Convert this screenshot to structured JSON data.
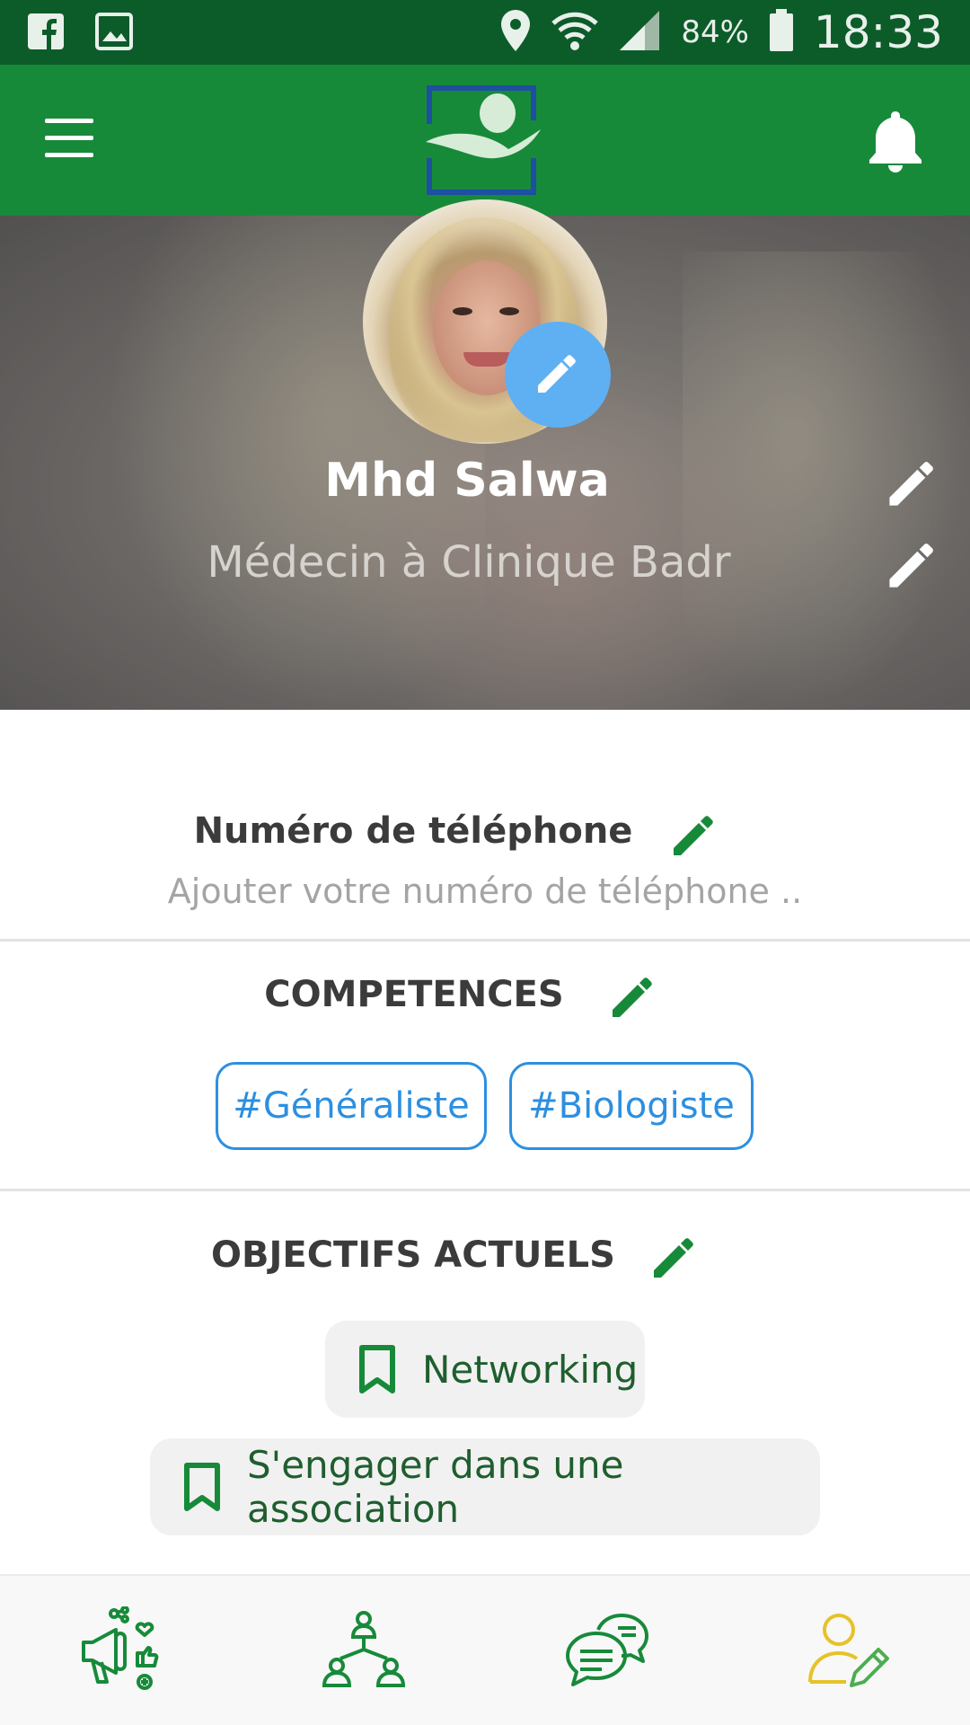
{
  "status_bar": {
    "battery": "84%",
    "time": "18:33",
    "icons": [
      "facebook-icon",
      "image-icon",
      "location-icon",
      "wifi-icon",
      "signal-icon",
      "battery-icon"
    ]
  },
  "app_bar": {
    "icons": [
      "menu-icon",
      "app-logo",
      "bell-icon"
    ]
  },
  "profile": {
    "name": "Mhd Salwa",
    "title": "Médecin à Clinique Badr"
  },
  "phone": {
    "label": "Numéro de téléphone",
    "placeholder": "Ajouter votre numéro de téléphone .."
  },
  "skills": {
    "label": "COMPETENCES",
    "items": [
      "#Généraliste",
      "#Biologiste"
    ]
  },
  "goals": {
    "label": "OBJECTIFS ACTUELS",
    "items": [
      "Networking",
      "S'engager dans une association"
    ]
  },
  "bottom_nav": {
    "items": [
      "megaphone-icon",
      "network-icon",
      "chat-icon",
      "profile-edit-icon"
    ],
    "active_index": 3
  },
  "colors": {
    "status_bar": "#0c5c2a",
    "app_bar": "#178a3a",
    "accent_green": "#178a3a",
    "chip_blue": "#2d8fe0",
    "avatar_edit_blue": "#5fb0f2",
    "active_nav": "#e6c229"
  }
}
